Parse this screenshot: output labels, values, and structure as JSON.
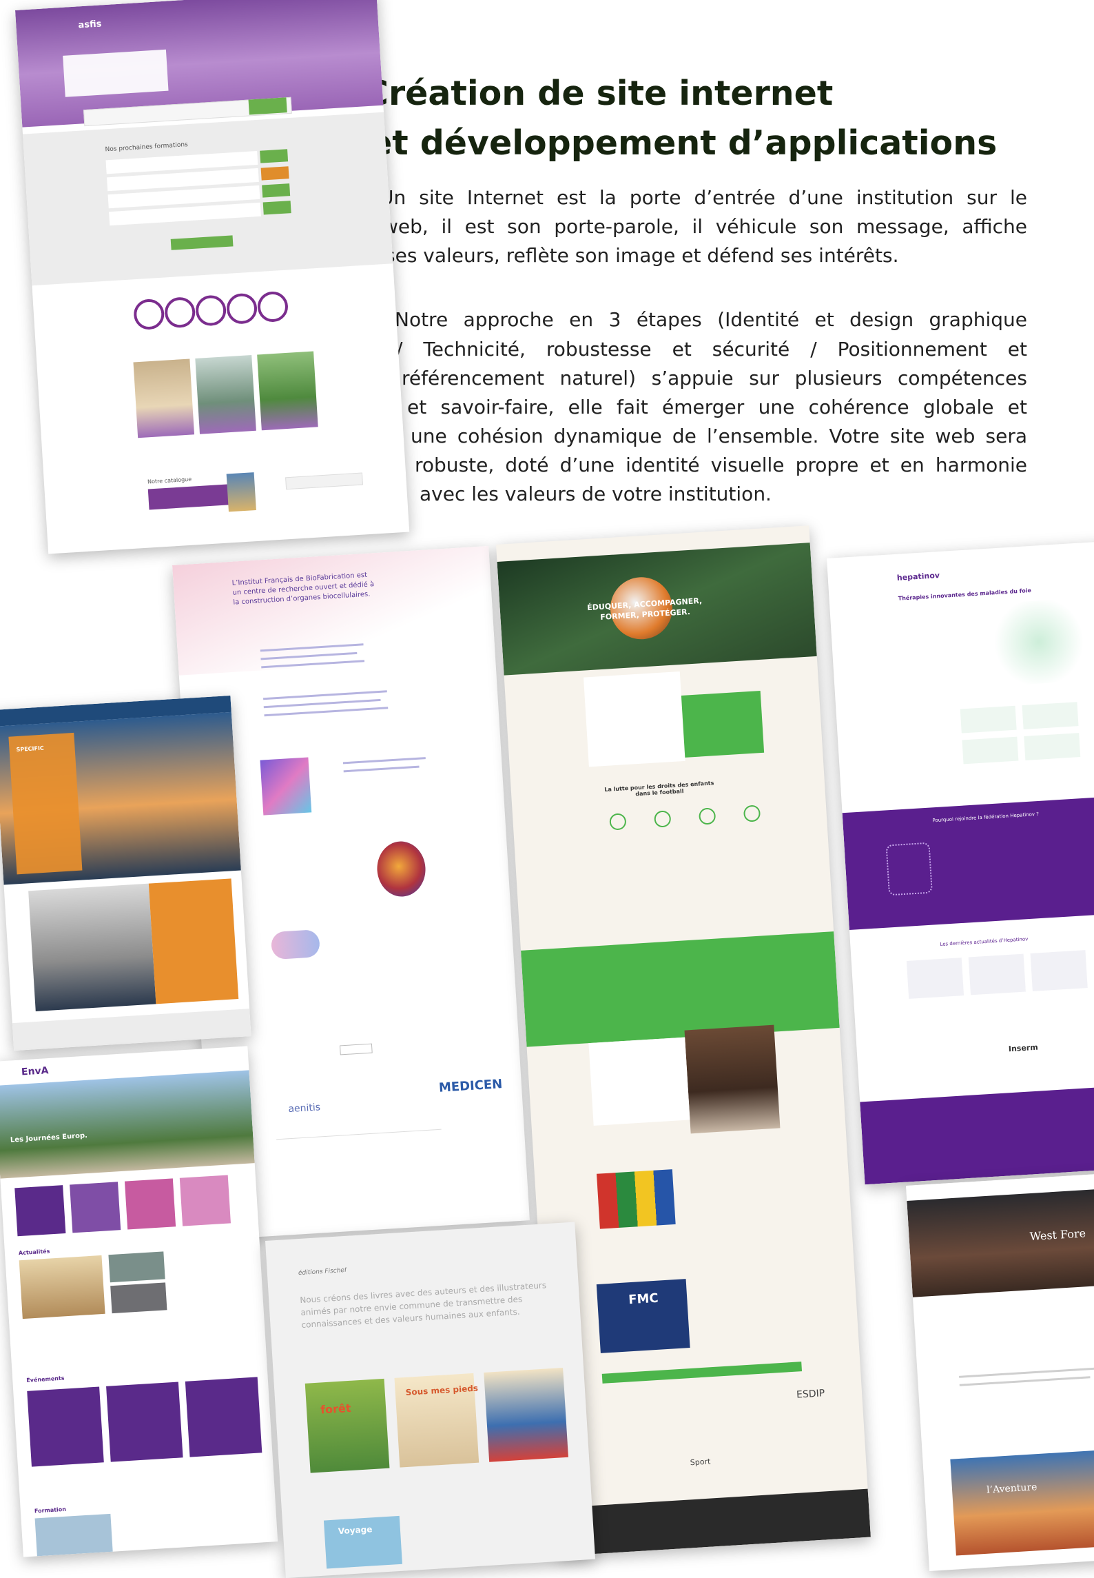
{
  "heading": {
    "line1": "Création de site internet",
    "line2": "et développement d’applications"
  },
  "intro": {
    "p1": [
      "Un site Internet est la porte d’entrée d’une institution sur le",
      "web, il est son porte-parole, il véhicule son message, affiche",
      "ses valeurs, reflète son image et défend ses intérêts."
    ],
    "p2": [
      "Notre approche en 3 étapes (Identité et design graphique",
      "/ Technicité, robustesse et sécurité / Positionnement et",
      "référencement naturel) s’appuie sur plusieurs compétences",
      "et savoir-faire, elle fait émerger une cohérence globale et",
      "une cohésion dynamique de l’ensemble. Votre site web sera",
      "robuste, doté d’une identité visuelle propre et en harmonie",
      "avec les valeurs de votre institution."
    ]
  },
  "screens": {
    "asfis": {
      "logo": "asfis",
      "section": "Nos prochaines formations",
      "catalogue": "Notre catalogue"
    },
    "biofab": {
      "heading": "L’Institut Français de BioFabrication est un centre de recherche ouvert et dédié à la construction d’organes biocellulaires.",
      "logo1": "aenitis",
      "logo2": "MEDICEN"
    },
    "football": {
      "hero": "ÉDUQUER, ACCOMPAGNER, FORMER, PROTÉGER.",
      "section": "La lutte pour les droits des enfants dans le football",
      "badge": "FMC",
      "logo": "ESDIP",
      "sport": "Sport"
    },
    "hepatinov": {
      "logo": "hepatinov",
      "title": "Thérapies innovantes des maladies du foie",
      "band": "Pourquoi rejoindre la fédération Hepatinov ?",
      "news": "Les dernières actualités d’Hepatinov",
      "partner": "Inserm"
    },
    "energy": {
      "label": "SPECIFIC"
    },
    "envia": {
      "logo": "EnvA",
      "hero": "Les Journées Europ.",
      "news": "Actualités",
      "events": "Événements",
      "formation": "Formation"
    },
    "fischef": {
      "logo": "éditions Fischef",
      "text": "Nous créons des livres avec des auteurs et des illustrateurs animés par notre envie commune de transmettre des connaissances et des valeurs humaines aux enfants.",
      "book1": "forêt",
      "book2": "Sous mes pieds",
      "book3": "Voyage"
    },
    "travel": {
      "hero": "West Fore",
      "sub": "l’Aventure"
    }
  },
  "colors": {
    "purple": "#6c2a8f",
    "green": "#4cb54b",
    "dark_green": "#16240f",
    "orange": "#e88f2d"
  }
}
